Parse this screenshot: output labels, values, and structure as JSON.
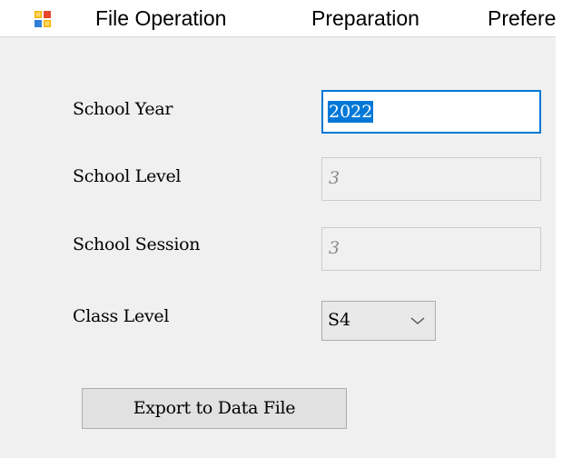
{
  "menubar": {
    "app_icon": "app-icon",
    "items": [
      {
        "label": "File Operation"
      },
      {
        "label": "Preparation"
      },
      {
        "label": "Prefere"
      }
    ]
  },
  "form": {
    "school_year": {
      "label": "School Year",
      "value": "2022",
      "focused": true,
      "text_selected": true
    },
    "school_level": {
      "label": "School Level",
      "value": "3",
      "enabled": false
    },
    "school_session": {
      "label": "School Session",
      "value": "3",
      "enabled": false
    },
    "class_level": {
      "label": "Class Level",
      "value": "S4"
    }
  },
  "actions": {
    "export_label": "Export to Data File"
  },
  "colors": {
    "focus_border": "#0078d7",
    "selection": "#0078d7",
    "window_bg": "#f0f0f0",
    "disabled_text": "#8a8a8a"
  }
}
